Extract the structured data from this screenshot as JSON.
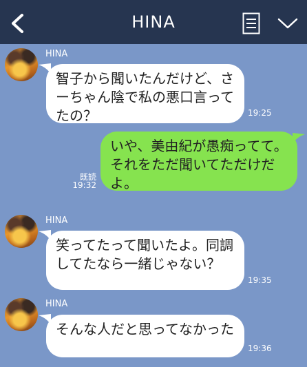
{
  "header": {
    "title": "HINA",
    "back_icon": "chevron-left-icon",
    "memo_icon": "note-icon",
    "menu_icon": "chevron-down-icon"
  },
  "colors": {
    "header_bg": "#263550",
    "chat_bg": "#7a97c8",
    "incoming_bubble": "#ffffff",
    "outgoing_bubble": "#86e34f"
  },
  "messages": [
    {
      "direction": "incoming",
      "sender": "HINA",
      "text": "智子から聞いたんだけど、さーちゃん陰で私の悪口言ってたの？",
      "time": "19:25"
    },
    {
      "direction": "outgoing",
      "text": "いや、美由紀が愚痴ってて。それをただ聞いてただけだよ。",
      "read": "既読",
      "time": "19:32"
    },
    {
      "direction": "incoming",
      "sender": "HINA",
      "text": "笑ってたって聞いたよ。同調してたなら一緒じゃない？",
      "time": "19:35"
    },
    {
      "direction": "incoming",
      "sender": "HINA",
      "text": "そんな人だと思ってなかった",
      "time": "19:36"
    }
  ]
}
